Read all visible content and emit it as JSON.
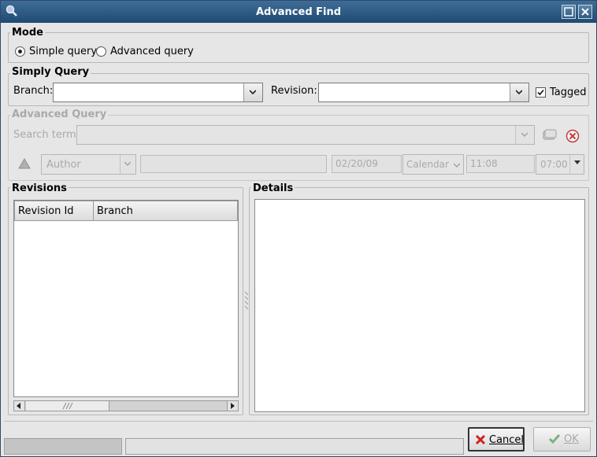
{
  "window": {
    "title": "Advanced Find"
  },
  "mode": {
    "group_title": "Mode",
    "options": [
      {
        "label": "Simple query",
        "selected": true
      },
      {
        "label": "Advanced query",
        "selected": false
      }
    ]
  },
  "simple_query": {
    "group_title": "Simply Query",
    "branch_label": "Branch:",
    "branch_value": "",
    "revision_label": "Revision:",
    "revision_value": "",
    "tagged_label": "Tagged",
    "tagged_checked": true
  },
  "advanced_query": {
    "group_title": "Advanced Query",
    "search_term_label": "Search term:",
    "field_combo": "Author",
    "value_field": "",
    "date": "02/20/09",
    "calendar_combo": "Calendar",
    "time": "11:08",
    "timezone": "07:00"
  },
  "revisions": {
    "group_title": "Revisions",
    "columns": [
      "Revision Id",
      "Branch"
    ],
    "rows": []
  },
  "details": {
    "group_title": "Details",
    "content": ""
  },
  "buttons": {
    "cancel": "Cancel",
    "ok": "OK"
  },
  "colors": {
    "titlebar": "#1f4a72",
    "window_bg": "#e6e6e6",
    "disabled_text": "#a9a9a9",
    "cancel_icon": "#cc2222",
    "ok_icon": "#7fb07f"
  }
}
